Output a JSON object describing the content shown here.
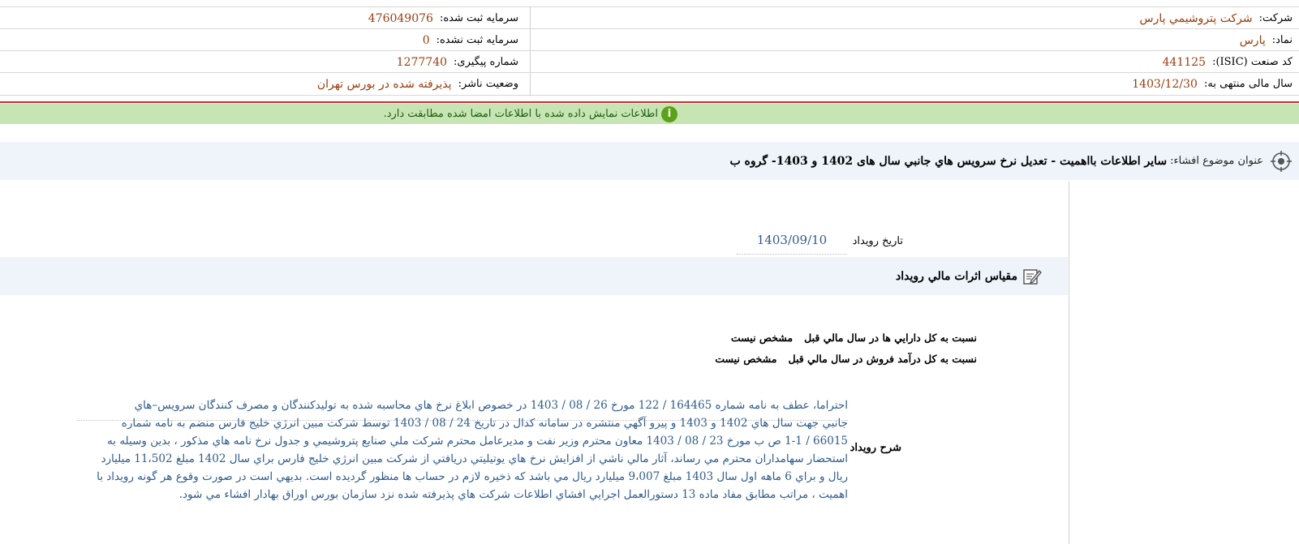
{
  "header": {
    "company_label": "شرکت:",
    "company_value": "شرکت پتروشيمي پارس",
    "registered_capital_label": "سرمایه ثبت شده:",
    "registered_capital_value": "476049076",
    "symbol_label": "نماد:",
    "symbol_value": "پارس",
    "unregistered_capital_label": "سرمایه ثبت نشده:",
    "unregistered_capital_value": "0",
    "isic_label": "کد صنعت (ISIC):",
    "isic_value": "441125",
    "tracking_label": "شماره پیگیری:",
    "tracking_value": "1277740",
    "fiscal_year_label": "سال مالی منتهی به:",
    "fiscal_year_value": "1403/12/30",
    "publisher_status_label": "وضعیت ناشر:",
    "publisher_status_value": "پذيرفته شده در بورس تهران"
  },
  "notice": {
    "icon": "info-icon",
    "text": "اطلاعات نمایش داده شده با اطلاعات امضا شده مطابقت دارد."
  },
  "subject": {
    "icon": "target-icon",
    "label": "عنوان موضوع افشاء:",
    "value": "ساير اطلاعات بااهميت - تعديل نرخ سرويس هاي جانبي سال های 1402 و 1403- گروه ب"
  },
  "event": {
    "date_label": "تاريخ رويداد",
    "date_value": "1403/09/10",
    "compare_title": "مقياس اثرات مالي رويداد",
    "compare_icon": "edit-icon",
    "ratio_assets_label": "نسبت به کل دارايي ها در سال مالي قبل",
    "ratio_assets_value": "مشخص نيست",
    "ratio_revenue_label": "نسبت به کل درآمد فروش در سال مالي قبل",
    "ratio_revenue_value": "مشخص نيست",
    "description_label": "شرح رويداد",
    "description_text": "احتراما، عطف به نامه شماره 164465 / 122 مورخ 26 / 08 / 1403 در خصوص ابلاغ نرخ هاي محاسبه شده به توليدکنندگان و مصرف کنندگان سرويس–هاي\nجانبي جهت سال هاي 1402 و 1403 و پيرو آگهي منتشره در سامانه کدال در تاريخ 24 / 08 / 1403 توسط شرکت مبين انرژي خليج فارس منضم به نامه شماره\n66015 / 1-1 ص ب مورخ 23 / 08 / 1403 معاون محترم وزير نفت و مديرعامل محترم شرکت ملي صنايع پتروشيمي و جدول نرخ نامه هاي مذکور ، بدين وسيله به\nاستحضار سهامداران محترم مي رساند، آثار مالي ناشي از افزايش نرخ هاي يوتيليتي دريافتي از شرکت مبين انرژي خليج فارس براي سال 1402 مبلغ 11،502 ميليارد\nريال و براي 6 ماهه اول سال 1403 مبلغ 9،007 ميليارد ريال مي باشد که ذخيره لازم در حساب ها منظور گرديده است. بديهي است در صورت وقوع هر گونه رويداد با\nاهميت ، مراتب مطابق مفاد ماده 13 دستورالعمل اجرايي افشاي اطلاعات شرکت هاي پذيرفته شده نزد سازمان بورس اوراق بهادار افشاء مي شود."
  }
}
